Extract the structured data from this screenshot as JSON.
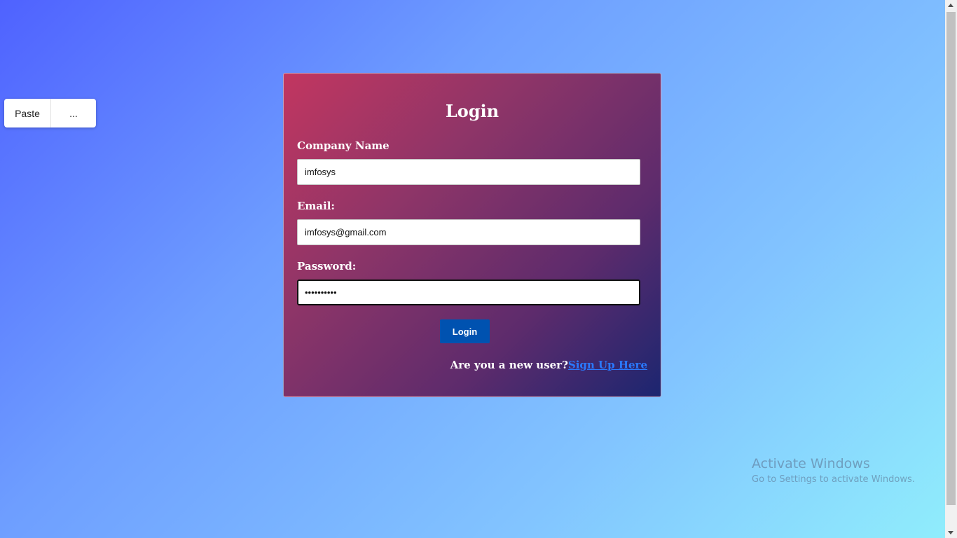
{
  "context_menu": {
    "paste_label": "Paste",
    "more_label": "..."
  },
  "login_form": {
    "title": "Login",
    "company_label": "Company Name",
    "company_value": "imfosys",
    "email_label": "Email:",
    "email_value": "imfosys@gmail.com",
    "password_label": "Password:",
    "password_value": "••••••••••",
    "submit_label": "Login",
    "new_user_text": "Are you a new user?",
    "signup_link": "Sign Up Here"
  },
  "watermark": {
    "title": "Activate Windows",
    "subtitle": "Go to Settings to activate Windows."
  },
  "colors": {
    "background_start": "#4f62ff",
    "background_end": "#90eefc",
    "card_start": "#c23660",
    "card_end": "#1c2670",
    "button": "#0052b0",
    "link": "#2a79ff"
  }
}
